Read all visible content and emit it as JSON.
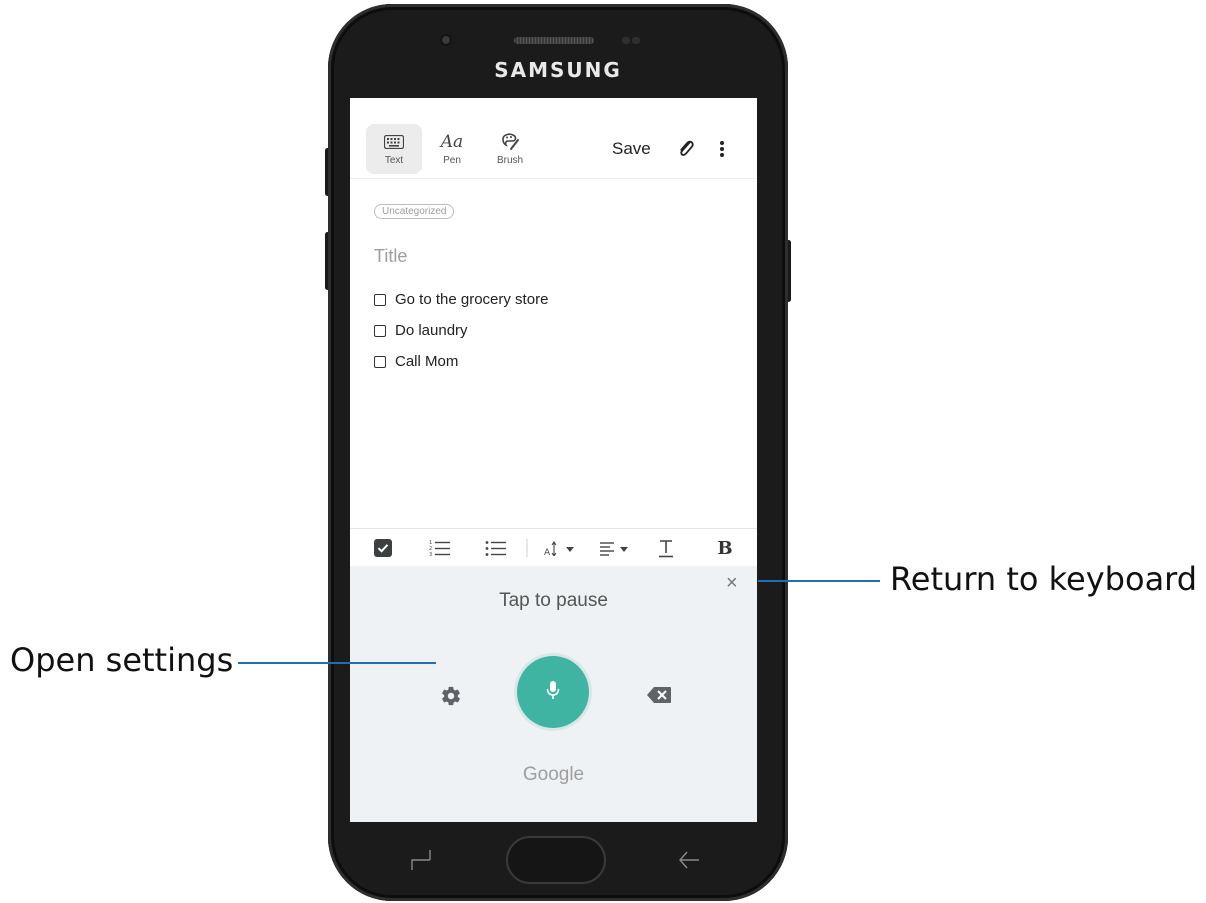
{
  "device": {
    "brand": "SAMSUNG"
  },
  "toolbar": {
    "modes": [
      {
        "label": "Text",
        "icon": "keyboard-icon",
        "active": true
      },
      {
        "label": "Pen",
        "icon": "handwriting-icon",
        "active": false
      },
      {
        "label": "Brush",
        "icon": "brush-icon",
        "active": false
      }
    ],
    "save_label": "Save",
    "attach_icon": "paperclip-icon",
    "more_icon": "more-vert-icon"
  },
  "note": {
    "category": "Uncategorized",
    "title_placeholder": "Title",
    "checklist": [
      {
        "text": "Go to the grocery store",
        "checked": false
      },
      {
        "text": "Do laundry",
        "checked": false
      },
      {
        "text": "Call Mom",
        "checked": false
      }
    ]
  },
  "format_bar": {
    "tools": [
      "checkbox-icon",
      "numbered-list-icon",
      "bullet-list-icon",
      "font-size-icon",
      "align-icon",
      "underline-icon",
      "bold-icon"
    ],
    "bold_label": "B"
  },
  "voice_input": {
    "close_symbol": "×",
    "status": "Tap to pause",
    "powered_by": "Google",
    "mic_color": "#3fb4a3"
  },
  "callouts": {
    "return_keyboard": "Return to keyboard",
    "open_settings": "Open settings"
  },
  "colors": {
    "callout_line": "#1f6fb2",
    "panel_bg": "#eef2f4"
  }
}
